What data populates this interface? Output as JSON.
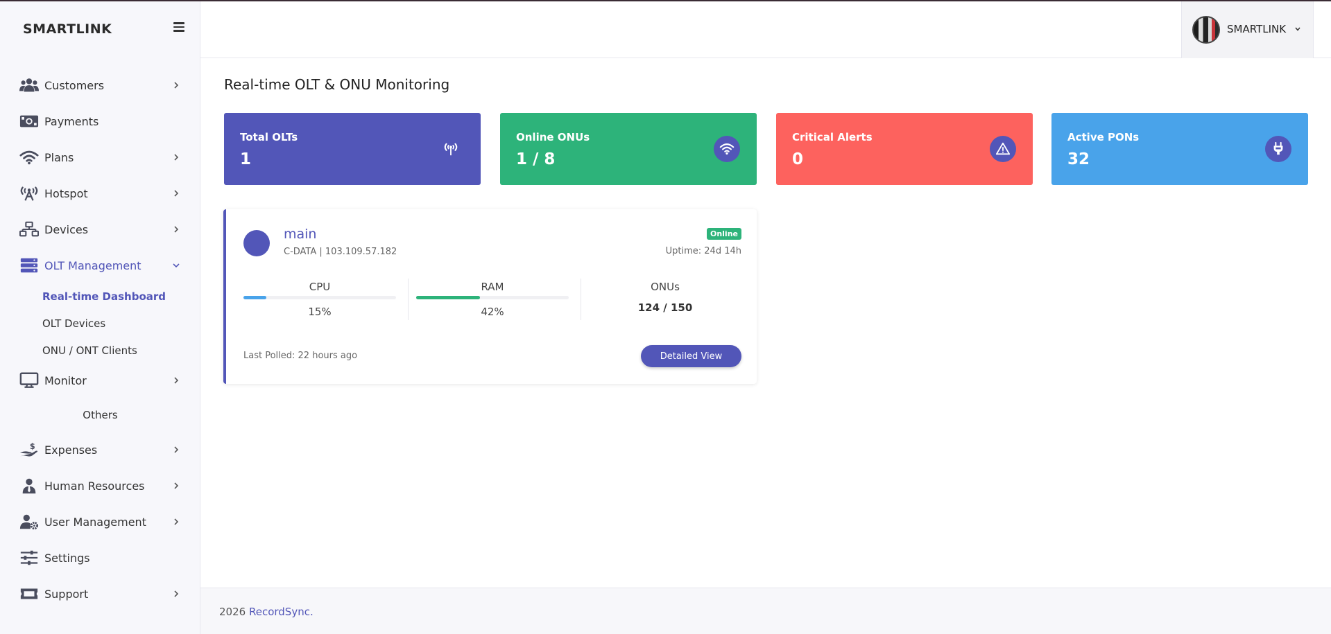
{
  "brand": "SMARTLINK",
  "user": {
    "name": "SMARTLINK"
  },
  "sidebar": {
    "items": [
      {
        "label": "Customers",
        "icon": "users-icon"
      },
      {
        "label": "Payments",
        "icon": "money-icon"
      },
      {
        "label": "Plans",
        "icon": "wifi-icon"
      },
      {
        "label": "Hotspot",
        "icon": "broadcast-tower-icon"
      },
      {
        "label": "Devices",
        "icon": "network-icon"
      },
      {
        "label": "OLT Management",
        "icon": "server-icon"
      },
      {
        "label": "Monitor",
        "icon": "monitor-icon"
      },
      {
        "label": "Expenses",
        "icon": "hand-dollar-icon"
      },
      {
        "label": "Human Resources",
        "icon": "user-tie-icon"
      },
      {
        "label": "User Management",
        "icon": "user-gear-icon"
      },
      {
        "label": "Settings",
        "icon": "sliders-icon"
      },
      {
        "label": "Support",
        "icon": "ticket-icon"
      }
    ],
    "olt_subitems": [
      "Real-time Dashboard",
      "OLT Devices",
      "ONU / ONT Clients"
    ],
    "section_others": "Others"
  },
  "page": {
    "title": "Real-time OLT & ONU Monitoring"
  },
  "stats": [
    {
      "title": "Total OLTs",
      "value": "1",
      "color": "#5256b8",
      "icon": "antenna-icon"
    },
    {
      "title": "Online ONUs",
      "value": "1 / 8",
      "color": "#2db37a",
      "icon": "wifi-icon"
    },
    {
      "title": "Critical Alerts",
      "value": "0",
      "color": "#fd625e",
      "icon": "warning-icon"
    },
    {
      "title": "Active PONs",
      "value": "32",
      "color": "#49a3ea",
      "icon": "plug-icon"
    }
  ],
  "olt": {
    "name": "main",
    "subtitle": "C-DATA | 103.109.57.182",
    "status": "Online",
    "uptime": "Uptime: 24d 14h",
    "cpu": {
      "label": "CPU",
      "value": "15%",
      "fraction": 0.15,
      "color": "#49a3ea"
    },
    "ram": {
      "label": "RAM",
      "value": "42%",
      "fraction": 0.42,
      "color": "#2db37a"
    },
    "onus": {
      "label": "ONUs",
      "value": "124 / 150"
    },
    "last_polled": "Last Polled: 22 hours ago",
    "detail_button": "Detailed View"
  },
  "footer": {
    "year": "2026",
    "link": "RecordSync."
  }
}
